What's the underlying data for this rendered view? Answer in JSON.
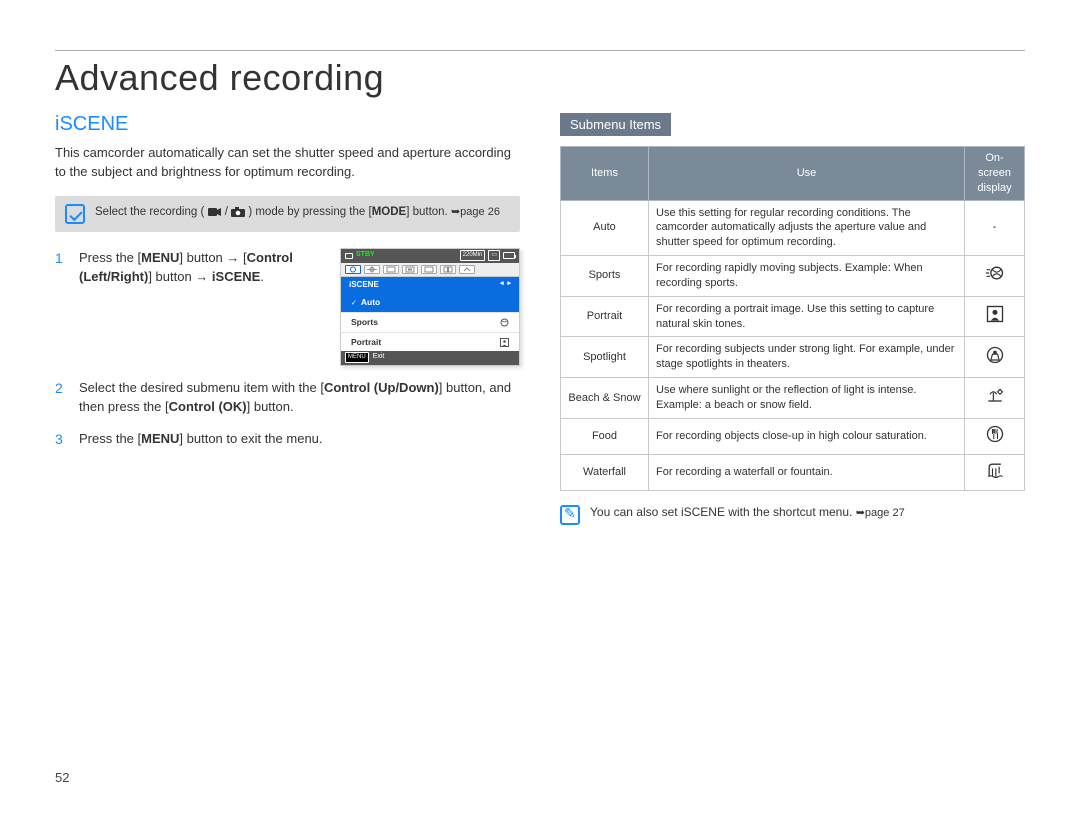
{
  "page_title": "Advanced recording",
  "page_number": "52",
  "section": {
    "heading": "iSCENE",
    "intro": "This camcorder automatically can set the shutter speed and aperture according to the subject and brightness for optimum recording.",
    "graybox_prefix": "Select the recording (",
    "graybox_suffix": ") mode by pressing the [",
    "graybox_mode": "MODE",
    "graybox_tail": "] button. ",
    "graybox_pageref": "page 26"
  },
  "steps": [
    {
      "num": "1",
      "parts": {
        "a": "Press the [",
        "menu": "MENU",
        "b": "] button → [",
        "ctrl": "Control (Left/Right)",
        "c": "] button → ",
        "iscene": "iSCENE",
        "d": "."
      }
    },
    {
      "num": "2",
      "parts": {
        "a": "Select the desired submenu item with the [",
        "ctrl": "Control (Up/Down)",
        "b": "] button, and then press the [",
        "ok": "Control (OK)",
        "c": "] button."
      }
    },
    {
      "num": "3",
      "parts": {
        "a": "Press the [",
        "menu": "MENU",
        "b": "] button to exit the menu."
      }
    }
  ],
  "screenshot": {
    "stby": "STBY",
    "time": "220Min",
    "header": "iSCENE",
    "rows": [
      "Auto",
      "Sports",
      "Portrait"
    ],
    "footer_menu": "MENU",
    "footer_exit": "Exit"
  },
  "submenu_label": "Submenu Items",
  "table": {
    "headers": [
      "Items",
      "Use",
      "On-screen display"
    ],
    "rows": [
      {
        "item": "Auto",
        "use": "Use this setting for regular recording conditions. The camcorder automatically adjusts the aperture value and shutter speed for optimum recording.",
        "icon": "-"
      },
      {
        "item": "Sports",
        "use": "For recording rapidly moving subjects. Example: When recording sports.",
        "icon": "sports"
      },
      {
        "item": "Portrait",
        "use": "For recording a portrait image. Use this setting to capture natural skin tones.",
        "icon": "portrait"
      },
      {
        "item": "Spotlight",
        "use": "For recording subjects under strong light. For example, under stage spotlights in theaters.",
        "icon": "spotlight"
      },
      {
        "item": "Beach & Snow",
        "use": "Use where sunlight or the reflection of light is intense. Example: a beach or snow field.",
        "icon": "beachsnow"
      },
      {
        "item": "Food",
        "use": "For recording objects close-up in high colour saturation.",
        "icon": "food"
      },
      {
        "item": "Waterfall",
        "use": "For recording a waterfall or fountain.",
        "icon": "waterfall"
      }
    ]
  },
  "note": {
    "text": "You can also set iSCENE with the shortcut menu. ",
    "pageref": "page 27"
  }
}
